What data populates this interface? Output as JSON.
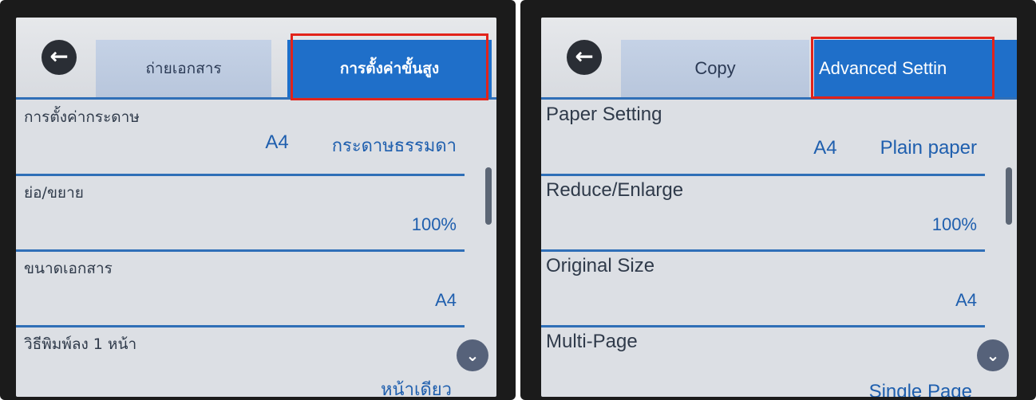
{
  "panels": [
    {
      "tabs": {
        "copy_label": "ถ่ายเอกสาร",
        "advanced_label": "การตั้งค่าขั้นสูง"
      },
      "rows": {
        "paper_setting": {
          "title": "การตั้งค่ากระดาษ",
          "size": "A4",
          "type": "กระดาษธรรมดา"
        },
        "reduce_enlarge": {
          "title": "ย่อ/ขยาย",
          "value": "100%"
        },
        "original_size": {
          "title": "ขนาดเอกสาร",
          "value": "A4"
        },
        "multi_page": {
          "title": "วิธีพิมพ์ลง 1 หน้า",
          "value": "หน้าเดียว"
        }
      }
    },
    {
      "tabs": {
        "copy_label": "Copy",
        "advanced_label": "Advanced Settin"
      },
      "rows": {
        "paper_setting": {
          "title": "Paper Setting",
          "size": "A4",
          "type": "Plain paper"
        },
        "reduce_enlarge": {
          "title": "Reduce/Enlarge",
          "value": "100%"
        },
        "original_size": {
          "title": "Original Size",
          "value": "A4"
        },
        "multi_page": {
          "title": "Multi-Page",
          "value": "Single Page"
        }
      }
    }
  ],
  "icons": {
    "back": "back-arrow-icon",
    "down": "chevron-down-icon"
  },
  "colors": {
    "active_tab": "#1f6fc9",
    "highlight": "#e2231a",
    "value_text": "#1f5fae"
  }
}
